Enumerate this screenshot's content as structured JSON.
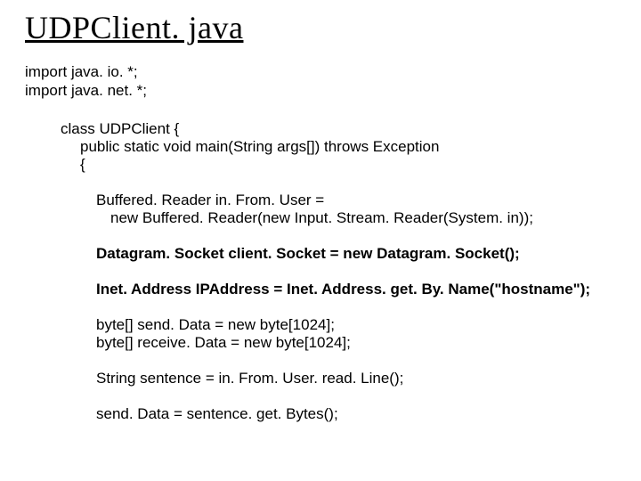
{
  "title": "UDPClient. java",
  "imports": {
    "line1": "import java. io. *;",
    "line2": "import java. net. *;"
  },
  "code": {
    "class_decl": "class UDPClient {",
    "main_sig": "public static void main(String args[]) throws Exception",
    "open_brace": "{",
    "br1a": "Buffered. Reader in. From. User =",
    "br1b": "new Buffered. Reader(new Input. Stream. Reader(System. in));",
    "dsock": "Datagram. Socket client. Socket = new Datagram. Socket();",
    "inet1": "Inet. Address IPAddress = Inet. Address. get. By. Name(\"hostname\");",
    "send_decl": "byte[] send. Data = new byte[1024];",
    "recv_decl": "byte[] receive. Data = new byte[1024];",
    "sentence": "String sentence = in. From. User. read. Line();",
    "tobytes": "send. Data = sentence. get. Bytes();"
  }
}
